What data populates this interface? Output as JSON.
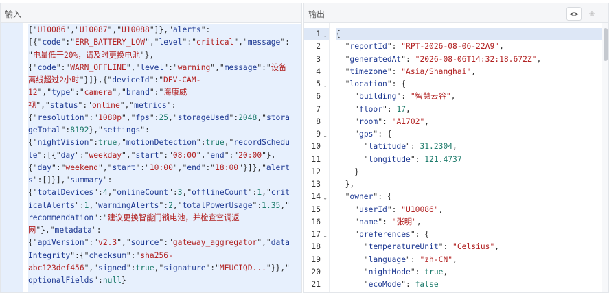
{
  "input_pane": {
    "title": "输入",
    "lines": [
      [
        [
          "p",
          "[\""
        ],
        [
          "s",
          "U10086"
        ],
        [
          "p",
          "\",\""
        ],
        [
          "s",
          "U10087"
        ],
        [
          "p",
          "\",\""
        ],
        [
          "s",
          "U10088"
        ],
        [
          "p",
          "\"]},\""
        ],
        [
          "k",
          "alerts"
        ],
        [
          "p",
          "\":"
        ]
      ],
      [
        [
          "p",
          "[{\""
        ],
        [
          "k",
          "code"
        ],
        [
          "p",
          "\":\""
        ],
        [
          "s",
          "ERR_BATTERY_LOW"
        ],
        [
          "p",
          "\",\""
        ],
        [
          "k",
          "level"
        ],
        [
          "p",
          "\":\""
        ],
        [
          "s",
          "critical"
        ],
        [
          "p",
          "\",\""
        ],
        [
          "k",
          "message"
        ],
        [
          "p",
          "\":"
        ]
      ],
      [
        [
          "p",
          "\""
        ],
        [
          "s",
          "电量低于20%，请及时更换电池"
        ],
        [
          "p",
          "\"},"
        ]
      ],
      [
        [
          "p",
          "{\""
        ],
        [
          "k",
          "code"
        ],
        [
          "p",
          "\":\""
        ],
        [
          "s",
          "WARN_OFFLINE"
        ],
        [
          "p",
          "\",\""
        ],
        [
          "k",
          "level"
        ],
        [
          "p",
          "\":\""
        ],
        [
          "s",
          "warning"
        ],
        [
          "p",
          "\",\""
        ],
        [
          "k",
          "message"
        ],
        [
          "p",
          "\":\""
        ],
        [
          "s",
          "设备"
        ]
      ],
      [
        [
          "s",
          "离线超过2小时"
        ],
        [
          "p",
          "\"}]},{\""
        ],
        [
          "k",
          "deviceId"
        ],
        [
          "p",
          "\":\""
        ],
        [
          "s",
          "DEV-CAM-"
        ]
      ],
      [
        [
          "s",
          "12"
        ],
        [
          "p",
          "\",\""
        ],
        [
          "k",
          "type"
        ],
        [
          "p",
          "\":\""
        ],
        [
          "s",
          "camera"
        ],
        [
          "p",
          "\",\""
        ],
        [
          "k",
          "brand"
        ],
        [
          "p",
          "\":\""
        ],
        [
          "s",
          "海康威"
        ]
      ],
      [
        [
          "s",
          "视"
        ],
        [
          "p",
          "\",\""
        ],
        [
          "k",
          "status"
        ],
        [
          "p",
          "\":\""
        ],
        [
          "s",
          "online"
        ],
        [
          "p",
          "\",\""
        ],
        [
          "k",
          "metrics"
        ],
        [
          "p",
          "\":"
        ]
      ],
      [
        [
          "p",
          "{\""
        ],
        [
          "k",
          "resolution"
        ],
        [
          "p",
          "\":\""
        ],
        [
          "s",
          "1080p"
        ],
        [
          "p",
          "\",\""
        ],
        [
          "k",
          "fps"
        ],
        [
          "p",
          "\":"
        ],
        [
          "n",
          "25"
        ],
        [
          "p",
          ",\""
        ],
        [
          "k",
          "storageUsed"
        ],
        [
          "p",
          "\":"
        ],
        [
          "n",
          "2048"
        ],
        [
          "p",
          ",\""
        ],
        [
          "k",
          "stora"
        ]
      ],
      [
        [
          "k",
          "geTotal"
        ],
        [
          "p",
          "\":"
        ],
        [
          "n",
          "8192"
        ],
        [
          "p",
          "},\""
        ],
        [
          "k",
          "settings"
        ],
        [
          "p",
          "\":"
        ]
      ],
      [
        [
          "p",
          "{\""
        ],
        [
          "k",
          "nightVision"
        ],
        [
          "p",
          "\":"
        ],
        [
          "n",
          "true"
        ],
        [
          "p",
          ",\""
        ],
        [
          "k",
          "motionDetection"
        ],
        [
          "p",
          "\":"
        ],
        [
          "n",
          "true"
        ],
        [
          "p",
          ",\""
        ],
        [
          "k",
          "recordSchedu"
        ]
      ],
      [
        [
          "k",
          "le"
        ],
        [
          "p",
          "\":[{\""
        ],
        [
          "k",
          "day"
        ],
        [
          "p",
          "\":\""
        ],
        [
          "s",
          "weekday"
        ],
        [
          "p",
          "\",\""
        ],
        [
          "k",
          "start"
        ],
        [
          "p",
          "\":\""
        ],
        [
          "s",
          "08:00"
        ],
        [
          "p",
          "\",\""
        ],
        [
          "k",
          "end"
        ],
        [
          "p",
          "\":\""
        ],
        [
          "s",
          "20:00"
        ],
        [
          "p",
          "\"},"
        ]
      ],
      [
        [
          "p",
          "{\""
        ],
        [
          "k",
          "day"
        ],
        [
          "p",
          "\":\""
        ],
        [
          "s",
          "weekend"
        ],
        [
          "p",
          "\",\""
        ],
        [
          "k",
          "start"
        ],
        [
          "p",
          "\":\""
        ],
        [
          "s",
          "10:00"
        ],
        [
          "p",
          "\",\""
        ],
        [
          "k",
          "end"
        ],
        [
          "p",
          "\":\""
        ],
        [
          "s",
          "18:00"
        ],
        [
          "p",
          "\"}]},\""
        ],
        [
          "k",
          "alert"
        ]
      ],
      [
        [
          "k",
          "s"
        ],
        [
          "p",
          "\":[]}],\""
        ],
        [
          "k",
          "summary"
        ],
        [
          "p",
          "\":"
        ]
      ],
      [
        [
          "p",
          "{\""
        ],
        [
          "k",
          "totalDevices"
        ],
        [
          "p",
          "\":"
        ],
        [
          "n",
          "4"
        ],
        [
          "p",
          ",\""
        ],
        [
          "k",
          "onlineCount"
        ],
        [
          "p",
          "\":"
        ],
        [
          "n",
          "3"
        ],
        [
          "p",
          ",\""
        ],
        [
          "k",
          "offlineCount"
        ],
        [
          "p",
          "\":"
        ],
        [
          "n",
          "1"
        ],
        [
          "p",
          ",\""
        ],
        [
          "k",
          "crit"
        ]
      ],
      [
        [
          "k",
          "icalAlerts"
        ],
        [
          "p",
          "\":"
        ],
        [
          "n",
          "1"
        ],
        [
          "p",
          ",\""
        ],
        [
          "k",
          "warningAlerts"
        ],
        [
          "p",
          "\":"
        ],
        [
          "n",
          "2"
        ],
        [
          "p",
          ",\""
        ],
        [
          "k",
          "totalPowerUsage"
        ],
        [
          "p",
          "\":"
        ],
        [
          "n",
          "1.35"
        ],
        [
          "p",
          ",\""
        ]
      ],
      [
        [
          "k",
          "recommendation"
        ],
        [
          "p",
          "\":\""
        ],
        [
          "s",
          "建议更换智能门锁电池，并检查空调返"
        ]
      ],
      [
        [
          "s",
          "网"
        ],
        [
          "p",
          "\"},\""
        ],
        [
          "k",
          "metadata"
        ],
        [
          "p",
          "\":"
        ]
      ],
      [
        [
          "p",
          "{\""
        ],
        [
          "k",
          "apiVersion"
        ],
        [
          "p",
          "\":\""
        ],
        [
          "s",
          "v2.3"
        ],
        [
          "p",
          "\",\""
        ],
        [
          "k",
          "source"
        ],
        [
          "p",
          "\":\""
        ],
        [
          "s",
          "gateway_aggregator"
        ],
        [
          "p",
          "\",\""
        ],
        [
          "k",
          "data"
        ]
      ],
      [
        [
          "k",
          "Integrity"
        ],
        [
          "p",
          "\":{\""
        ],
        [
          "k",
          "checksum"
        ],
        [
          "p",
          "\":\""
        ],
        [
          "s",
          "sha256-"
        ]
      ],
      [
        [
          "s",
          "abc123def456"
        ],
        [
          "p",
          "\",\""
        ],
        [
          "k",
          "signed"
        ],
        [
          "p",
          "\":"
        ],
        [
          "n",
          "true"
        ],
        [
          "p",
          ",\""
        ],
        [
          "k",
          "signature"
        ],
        [
          "p",
          "\":\""
        ],
        [
          "s",
          "MEUCIQD..."
        ],
        [
          "p",
          "\"}},\""
        ]
      ],
      [
        [
          "k",
          "optionalFields"
        ],
        [
          "p",
          "\":"
        ],
        [
          "n",
          "null"
        ],
        [
          "p",
          "}"
        ]
      ]
    ]
  },
  "output_pane": {
    "title": "输出",
    "buttons": {
      "format": "<>",
      "compress": "⁜"
    },
    "line_numbers": [
      "1",
      "2",
      "3",
      "4",
      "5",
      "6",
      "7",
      "8",
      "9",
      "10",
      "11",
      "12",
      "13",
      "14",
      "15",
      "16",
      "17",
      "18",
      "19",
      "20",
      "21"
    ],
    "folds": {
      "1": "⌄",
      "5": "⌄",
      "9": "⌄",
      "14": "⌄",
      "17": "⌄"
    },
    "lines": [
      [
        [
          "p",
          "{"
        ]
      ],
      [
        [
          "p",
          "  \""
        ],
        [
          "k",
          "reportId"
        ],
        [
          "p",
          "\": "
        ],
        [
          "s",
          "\"RPT-2026-08-06-22A9\""
        ],
        [
          "p",
          ","
        ]
      ],
      [
        [
          "p",
          "  \""
        ],
        [
          "k",
          "generatedAt"
        ],
        [
          "p",
          "\": "
        ],
        [
          "s",
          "\"2026-08-06T14:32:18.672Z\""
        ],
        [
          "p",
          ","
        ]
      ],
      [
        [
          "p",
          "  \""
        ],
        [
          "k",
          "timezone"
        ],
        [
          "p",
          "\": "
        ],
        [
          "s",
          "\"Asia/Shanghai\""
        ],
        [
          "p",
          ","
        ]
      ],
      [
        [
          "p",
          "  \""
        ],
        [
          "k",
          "location"
        ],
        [
          "p",
          "\": {"
        ]
      ],
      [
        [
          "p",
          "    \""
        ],
        [
          "k",
          "building"
        ],
        [
          "p",
          "\": "
        ],
        [
          "s",
          "\"智慧云谷\""
        ],
        [
          "p",
          ","
        ]
      ],
      [
        [
          "p",
          "    \""
        ],
        [
          "k",
          "floor"
        ],
        [
          "p",
          "\": "
        ],
        [
          "n",
          "17"
        ],
        [
          "p",
          ","
        ]
      ],
      [
        [
          "p",
          "    \""
        ],
        [
          "k",
          "room"
        ],
        [
          "p",
          "\": "
        ],
        [
          "s",
          "\"A1702\""
        ],
        [
          "p",
          ","
        ]
      ],
      [
        [
          "p",
          "    \""
        ],
        [
          "k",
          "gps"
        ],
        [
          "p",
          "\": {"
        ]
      ],
      [
        [
          "p",
          "      \""
        ],
        [
          "k",
          "latitude"
        ],
        [
          "p",
          "\": "
        ],
        [
          "n",
          "31.2304"
        ],
        [
          "p",
          ","
        ]
      ],
      [
        [
          "p",
          "      \""
        ],
        [
          "k",
          "longitude"
        ],
        [
          "p",
          "\": "
        ],
        [
          "n",
          "121.4737"
        ]
      ],
      [
        [
          "p",
          "    }"
        ]
      ],
      [
        [
          "p",
          "  },"
        ]
      ],
      [
        [
          "p",
          "  \""
        ],
        [
          "k",
          "owner"
        ],
        [
          "p",
          "\": {"
        ]
      ],
      [
        [
          "p",
          "    \""
        ],
        [
          "k",
          "userId"
        ],
        [
          "p",
          "\": "
        ],
        [
          "s",
          "\"U10086\""
        ],
        [
          "p",
          ","
        ]
      ],
      [
        [
          "p",
          "    \""
        ],
        [
          "k",
          "name"
        ],
        [
          "p",
          "\": "
        ],
        [
          "s",
          "\"张明\""
        ],
        [
          "p",
          ","
        ]
      ],
      [
        [
          "p",
          "    \""
        ],
        [
          "k",
          "preferences"
        ],
        [
          "p",
          "\": {"
        ]
      ],
      [
        [
          "p",
          "      \""
        ],
        [
          "k",
          "temperatureUnit"
        ],
        [
          "p",
          "\": "
        ],
        [
          "s",
          "\"Celsius\""
        ],
        [
          "p",
          ","
        ]
      ],
      [
        [
          "p",
          "      \""
        ],
        [
          "k",
          "language"
        ],
        [
          "p",
          "\": "
        ],
        [
          "s",
          "\"zh-CN\""
        ],
        [
          "p",
          ","
        ]
      ],
      [
        [
          "p",
          "      \""
        ],
        [
          "k",
          "nightMode"
        ],
        [
          "p",
          "\": "
        ],
        [
          "n",
          "true"
        ],
        [
          "p",
          ","
        ]
      ],
      [
        [
          "p",
          "      \""
        ],
        [
          "k",
          "ecoMode"
        ],
        [
          "p",
          "\": "
        ],
        [
          "n",
          "false"
        ]
      ]
    ]
  }
}
